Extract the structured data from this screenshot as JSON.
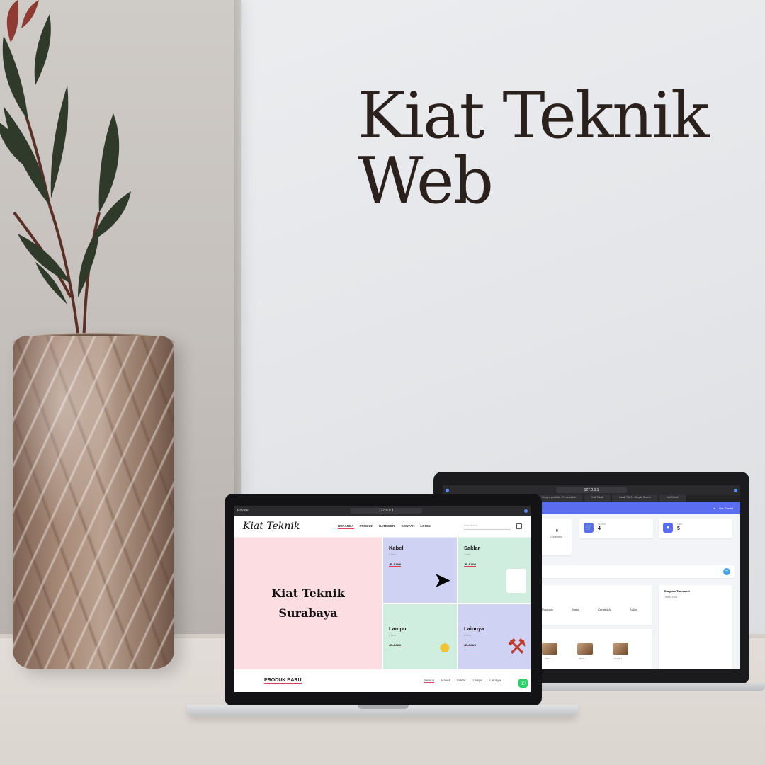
{
  "headline": {
    "line1": "Kiat Teknik",
    "line2": "Web"
  },
  "front_browser": {
    "private_label": "Private",
    "url": "127.0.0.1"
  },
  "site": {
    "brand": "Kiat Teknik",
    "menu": [
      "BERANDA",
      "PRODUK",
      "KATEGORI",
      "KONTAK",
      "LOGIN"
    ],
    "search_placeholder": "Cari di sini...",
    "hero_title": "Kiat Teknik Surabaya",
    "tiles": [
      {
        "title": "Kabel",
        "sub": "0 item",
        "link": "JELAJAHI",
        "icon": "cable-icon"
      },
      {
        "title": "Saklar",
        "sub": "0 item",
        "link": "JELAJAHI",
        "icon": "switch-icon"
      },
      {
        "title": "Lampu",
        "sub": "0 item",
        "link": "JELAJAHI",
        "icon": "bulb-icon"
      },
      {
        "title": "Lainnya",
        "sub": "0 item",
        "link": "JELAJAHI",
        "icon": "tools-icon"
      }
    ],
    "section_title": "PRODUK BARU",
    "filters": [
      "Semua",
      "Kabel",
      "Saklar",
      "Lampu",
      "Lainnya"
    ]
  },
  "back_browser": {
    "url": "127.0.0.1",
    "tabs": [
      "Copy of portfolio - Presentation",
      "Kiat Teknik",
      "install TW 3 - Google Search",
      "Kiat Teknik"
    ]
  },
  "admin": {
    "user": "Hai, Daniel",
    "stats": [
      {
        "label": "Completed",
        "value": "0"
      },
      {
        "label": "Product",
        "value": "4"
      },
      {
        "label": "User",
        "value": "5"
      }
    ],
    "table_headers": [
      "Products",
      "Status",
      "Created At",
      "Action"
    ],
    "chart_title": "Diagram Transaksi",
    "chart_subtitle": "Tahun 2023",
    "thumb_labels": [
      "Kabel",
      "Saklar 2",
      "Saklar 3"
    ]
  },
  "colors": {
    "accent": "#5a6cf0",
    "hero_pink": "#fbdde2",
    "tile_lavender": "#cfd2f2",
    "tile_mint": "#cfeee0",
    "whatsapp": "#25d366"
  }
}
